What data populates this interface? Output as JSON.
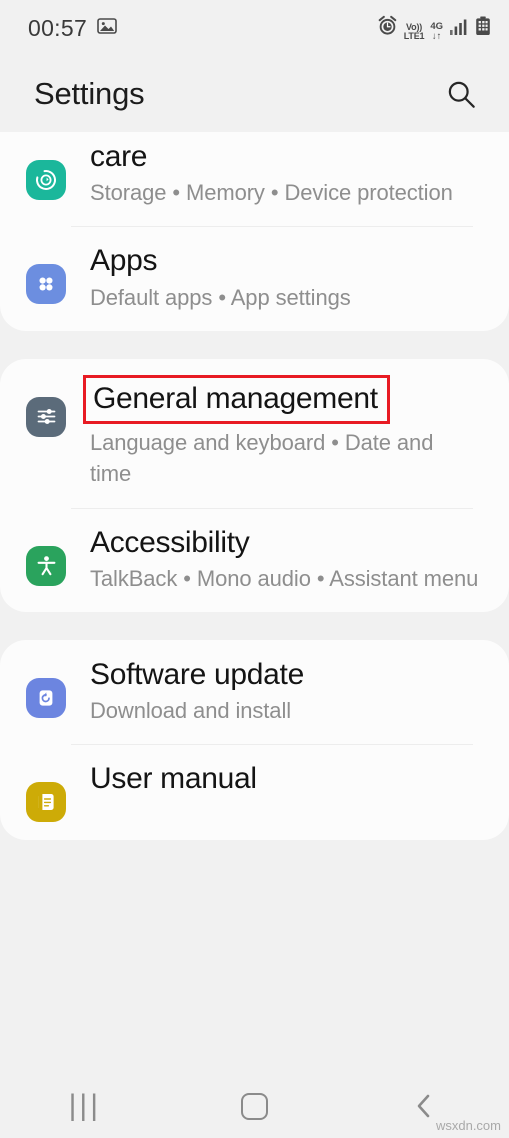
{
  "status_bar": {
    "clock": "00:57",
    "icons_left": [
      "image-icon"
    ],
    "icons_right": [
      "alarm-icon",
      "volte-icon",
      "network-icon",
      "signal-icon",
      "battery-icon"
    ],
    "volte_top": "Vo))",
    "volte_bottom": "LTE1",
    "network_label": "4G",
    "network_arrows": "↓↑"
  },
  "header": {
    "title": "Settings",
    "search_icon": "search-icon"
  },
  "colors": {
    "background": "#f1f1f1",
    "card": "#fcfcfc",
    "title_text": "#141414",
    "subtitle_text": "#8e8e8e",
    "annotation_red": "#e81b23",
    "device_care_icon": "#1bb79b",
    "apps_icon": "#6c8ee0",
    "general_management_icon": "#5b6b7a",
    "accessibility_icon": "#2aa35d",
    "software_update_icon": "#6c85e0",
    "user_manual_icon": "#cdab07"
  },
  "groups": [
    {
      "id": "group-1",
      "clipped_top": true,
      "items": [
        {
          "id": "device-care",
          "title": "care",
          "subtitle": "Storage • Memory • Device protection",
          "icon": "device-care-icon",
          "icon_color": "#1bb79b",
          "highlighted": false
        },
        {
          "id": "apps",
          "title": "Apps",
          "subtitle": "Default apps • App settings",
          "icon": "apps-grid-icon",
          "icon_color": "#6c8ee0",
          "highlighted": false
        }
      ]
    },
    {
      "id": "group-2",
      "clipped_top": false,
      "items": [
        {
          "id": "general-management",
          "title": "General management",
          "subtitle": "Language and keyboard • Date and time",
          "icon": "sliders-icon",
          "icon_color": "#5b6b7a",
          "highlighted": true
        },
        {
          "id": "accessibility",
          "title": "Accessibility",
          "subtitle": "TalkBack • Mono audio • Assistant menu",
          "icon": "accessibility-person-icon",
          "icon_color": "#2aa35d",
          "highlighted": false
        }
      ]
    },
    {
      "id": "group-3",
      "clipped_top": false,
      "items": [
        {
          "id": "software-update",
          "title": "Software update",
          "subtitle": "Download and install",
          "icon": "software-update-icon",
          "icon_color": "#6c85e0",
          "highlighted": false
        },
        {
          "id": "user-manual",
          "title": "User manual",
          "subtitle": "",
          "icon": "user-manual-icon",
          "icon_color": "#cdab07",
          "highlighted": false
        }
      ]
    }
  ],
  "nav_bar": {
    "recents_label": "|||",
    "recents_icon": "recents-icon",
    "home_icon": "home-icon",
    "back_icon": "back-icon"
  },
  "watermark": "wsxdn.com"
}
